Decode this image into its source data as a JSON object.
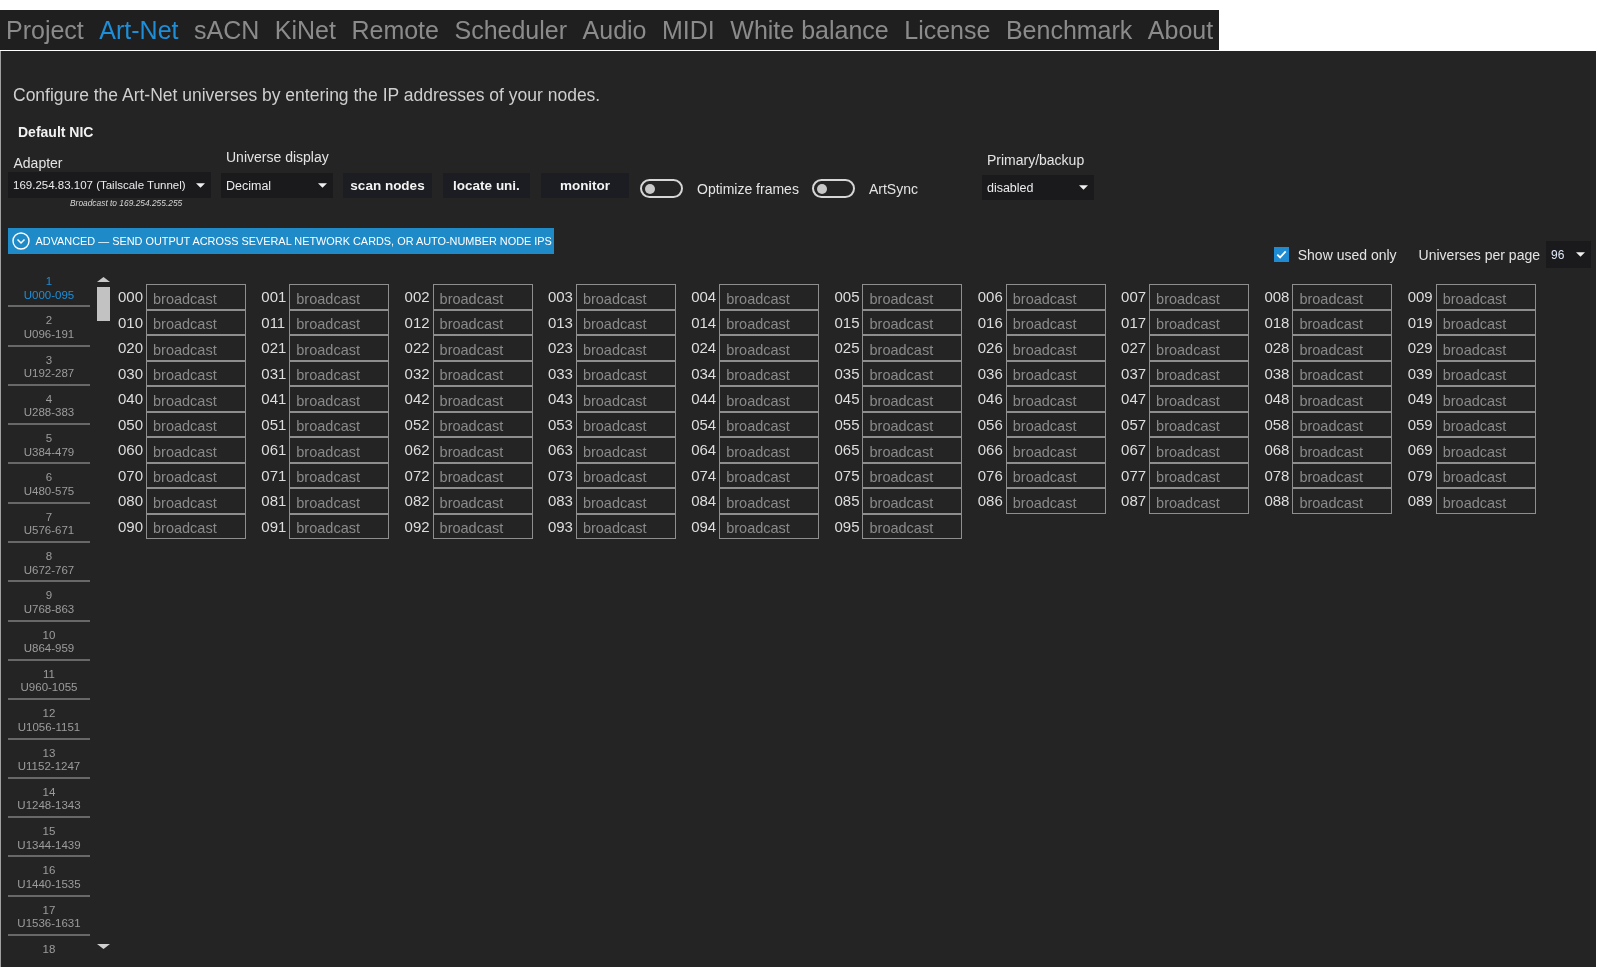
{
  "tabs": [
    {
      "label": "Project",
      "selected": false
    },
    {
      "label": "Art-Net",
      "selected": true
    },
    {
      "label": "sACN",
      "selected": false
    },
    {
      "label": "KiNet",
      "selected": false
    },
    {
      "label": "Remote",
      "selected": false
    },
    {
      "label": "Scheduler",
      "selected": false
    },
    {
      "label": "Audio",
      "selected": false
    },
    {
      "label": "MIDI",
      "selected": false
    },
    {
      "label": "White balance",
      "selected": false
    },
    {
      "label": "License",
      "selected": false
    },
    {
      "label": "Benchmark",
      "selected": false
    },
    {
      "label": "About",
      "selected": false
    }
  ],
  "description": "Configure the Art-Net universes by entering the IP addresses of your nodes.",
  "nic": {
    "heading": "Default NIC",
    "adapter": {
      "label": "Adapter",
      "value": "169.254.83.107 (Tailscale Tunnel)",
      "note": "Broadcast to 169.254.255.255"
    },
    "universe_display": {
      "label": "Universe display",
      "value": "Decimal"
    },
    "buttons": [
      "scan nodes",
      "locate uni.",
      "monitor"
    ],
    "toggles": [
      {
        "label": "Optimize frames",
        "on": false
      },
      {
        "label": "ArtSync",
        "on": false
      }
    ],
    "primary_backup": {
      "label": "Primary/backup",
      "value": "disabled"
    }
  },
  "advanced": {
    "label": "ADVANCED — SEND OUTPUT ACROSS SEVERAL NETWORK CARDS, OR AUTO-NUMBER NODE IPS"
  },
  "show_used_only": {
    "label": "Show used only",
    "checked": true
  },
  "universes_per_page": {
    "label": "Universes per page",
    "value": "96"
  },
  "pages": [
    {
      "number": "1",
      "range": "U000-095",
      "selected": true
    },
    {
      "number": "2",
      "range": "U096-191",
      "selected": false
    },
    {
      "number": "3",
      "range": "U192-287",
      "selected": false
    },
    {
      "number": "4",
      "range": "U288-383",
      "selected": false
    },
    {
      "number": "5",
      "range": "U384-479",
      "selected": false
    },
    {
      "number": "6",
      "range": "U480-575",
      "selected": false
    },
    {
      "number": "7",
      "range": "U576-671",
      "selected": false
    },
    {
      "number": "8",
      "range": "U672-767",
      "selected": false
    },
    {
      "number": "9",
      "range": "U768-863",
      "selected": false
    },
    {
      "number": "10",
      "range": "U864-959",
      "selected": false
    },
    {
      "number": "11",
      "range": "U960-1055",
      "selected": false
    },
    {
      "number": "12",
      "range": "U1056-1151",
      "selected": false
    },
    {
      "number": "13",
      "range": "U1152-1247",
      "selected": false
    },
    {
      "number": "14",
      "range": "U1248-1343",
      "selected": false
    },
    {
      "number": "15",
      "range": "U1344-1439",
      "selected": false
    },
    {
      "number": "16",
      "range": "U1440-1535",
      "selected": false
    },
    {
      "number": "17",
      "range": "U1536-1631",
      "selected": false
    },
    {
      "number": "18",
      "selected": false
    }
  ],
  "universes": [
    {
      "label": "000",
      "placeholder": "broadcast"
    },
    {
      "label": "001",
      "placeholder": "broadcast"
    },
    {
      "label": "002",
      "placeholder": "broadcast"
    },
    {
      "label": "003",
      "placeholder": "broadcast"
    },
    {
      "label": "004",
      "placeholder": "broadcast"
    },
    {
      "label": "005",
      "placeholder": "broadcast"
    },
    {
      "label": "006",
      "placeholder": "broadcast"
    },
    {
      "label": "007",
      "placeholder": "broadcast"
    },
    {
      "label": "008",
      "placeholder": "broadcast"
    },
    {
      "label": "009",
      "placeholder": "broadcast"
    },
    {
      "label": "010",
      "placeholder": "broadcast"
    },
    {
      "label": "011",
      "placeholder": "broadcast"
    },
    {
      "label": "012",
      "placeholder": "broadcast"
    },
    {
      "label": "013",
      "placeholder": "broadcast"
    },
    {
      "label": "014",
      "placeholder": "broadcast"
    },
    {
      "label": "015",
      "placeholder": "broadcast"
    },
    {
      "label": "016",
      "placeholder": "broadcast"
    },
    {
      "label": "017",
      "placeholder": "broadcast"
    },
    {
      "label": "018",
      "placeholder": "broadcast"
    },
    {
      "label": "019",
      "placeholder": "broadcast"
    },
    {
      "label": "020",
      "placeholder": "broadcast"
    },
    {
      "label": "021",
      "placeholder": "broadcast"
    },
    {
      "label": "022",
      "placeholder": "broadcast"
    },
    {
      "label": "023",
      "placeholder": "broadcast"
    },
    {
      "label": "024",
      "placeholder": "broadcast"
    },
    {
      "label": "025",
      "placeholder": "broadcast"
    },
    {
      "label": "026",
      "placeholder": "broadcast"
    },
    {
      "label": "027",
      "placeholder": "broadcast"
    },
    {
      "label": "028",
      "placeholder": "broadcast"
    },
    {
      "label": "029",
      "placeholder": "broadcast"
    },
    {
      "label": "030",
      "placeholder": "broadcast"
    },
    {
      "label": "031",
      "placeholder": "broadcast"
    },
    {
      "label": "032",
      "placeholder": "broadcast"
    },
    {
      "label": "033",
      "placeholder": "broadcast"
    },
    {
      "label": "034",
      "placeholder": "broadcast"
    },
    {
      "label": "035",
      "placeholder": "broadcast"
    },
    {
      "label": "036",
      "placeholder": "broadcast"
    },
    {
      "label": "037",
      "placeholder": "broadcast"
    },
    {
      "label": "038",
      "placeholder": "broadcast"
    },
    {
      "label": "039",
      "placeholder": "broadcast"
    },
    {
      "label": "040",
      "placeholder": "broadcast"
    },
    {
      "label": "041",
      "placeholder": "broadcast"
    },
    {
      "label": "042",
      "placeholder": "broadcast"
    },
    {
      "label": "043",
      "placeholder": "broadcast"
    },
    {
      "label": "044",
      "placeholder": "broadcast"
    },
    {
      "label": "045",
      "placeholder": "broadcast"
    },
    {
      "label": "046",
      "placeholder": "broadcast"
    },
    {
      "label": "047",
      "placeholder": "broadcast"
    },
    {
      "label": "048",
      "placeholder": "broadcast"
    },
    {
      "label": "049",
      "placeholder": "broadcast"
    },
    {
      "label": "050",
      "placeholder": "broadcast"
    },
    {
      "label": "051",
      "placeholder": "broadcast"
    },
    {
      "label": "052",
      "placeholder": "broadcast"
    },
    {
      "label": "053",
      "placeholder": "broadcast"
    },
    {
      "label": "054",
      "placeholder": "broadcast"
    },
    {
      "label": "055",
      "placeholder": "broadcast"
    },
    {
      "label": "056",
      "placeholder": "broadcast"
    },
    {
      "label": "057",
      "placeholder": "broadcast"
    },
    {
      "label": "058",
      "placeholder": "broadcast"
    },
    {
      "label": "059",
      "placeholder": "broadcast"
    },
    {
      "label": "060",
      "placeholder": "broadcast"
    },
    {
      "label": "061",
      "placeholder": "broadcast"
    },
    {
      "label": "062",
      "placeholder": "broadcast"
    },
    {
      "label": "063",
      "placeholder": "broadcast"
    },
    {
      "label": "064",
      "placeholder": "broadcast"
    },
    {
      "label": "065",
      "placeholder": "broadcast"
    },
    {
      "label": "066",
      "placeholder": "broadcast"
    },
    {
      "label": "067",
      "placeholder": "broadcast"
    },
    {
      "label": "068",
      "placeholder": "broadcast"
    },
    {
      "label": "069",
      "placeholder": "broadcast"
    },
    {
      "label": "070",
      "placeholder": "broadcast"
    },
    {
      "label": "071",
      "placeholder": "broadcast"
    },
    {
      "label": "072",
      "placeholder": "broadcast"
    },
    {
      "label": "073",
      "placeholder": "broadcast"
    },
    {
      "label": "074",
      "placeholder": "broadcast"
    },
    {
      "label": "075",
      "placeholder": "broadcast"
    },
    {
      "label": "076",
      "placeholder": "broadcast"
    },
    {
      "label": "077",
      "placeholder": "broadcast"
    },
    {
      "label": "078",
      "placeholder": "broadcast"
    },
    {
      "label": "079",
      "placeholder": "broadcast"
    },
    {
      "label": "080",
      "placeholder": "broadcast"
    },
    {
      "label": "081",
      "placeholder": "broadcast"
    },
    {
      "label": "082",
      "placeholder": "broadcast"
    },
    {
      "label": "083",
      "placeholder": "broadcast"
    },
    {
      "label": "084",
      "placeholder": "broadcast"
    },
    {
      "label": "085",
      "placeholder": "broadcast"
    },
    {
      "label": "086",
      "placeholder": "broadcast"
    },
    {
      "label": "087",
      "placeholder": "broadcast"
    },
    {
      "label": "088",
      "placeholder": "broadcast"
    },
    {
      "label": "089",
      "placeholder": "broadcast"
    },
    {
      "label": "090",
      "placeholder": "broadcast"
    },
    {
      "label": "091",
      "placeholder": "broadcast"
    },
    {
      "label": "092",
      "placeholder": "broadcast"
    },
    {
      "label": "093",
      "placeholder": "broadcast"
    },
    {
      "label": "094",
      "placeholder": "broadcast"
    },
    {
      "label": "095",
      "placeholder": "broadcast"
    }
  ]
}
